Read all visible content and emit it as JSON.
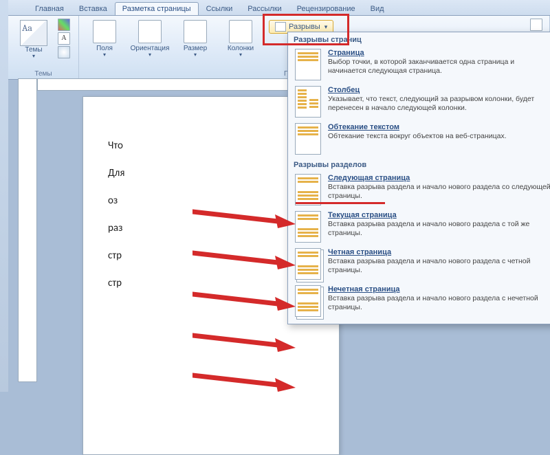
{
  "tabs": {
    "home": "Главная",
    "insert": "Вставка",
    "layout": "Разметка страницы",
    "refs": "Ссылки",
    "mail": "Рассылки",
    "review": "Рецензирование",
    "view": "Вид"
  },
  "ribbon": {
    "themes": {
      "btn": "Темы",
      "label": "Темы"
    },
    "pagesetup": {
      "margins": "Поля",
      "orient": "Ориентация",
      "size": "Размер",
      "cols": "Колонки",
      "label": "Параметры страни"
    },
    "breaks": "Разрывы"
  },
  "dropdown": {
    "sec1": "Разрывы страниц",
    "page": {
      "t": "Страница",
      "d": "Выбор точки, в которой заканчивается одна страница и начинается следующая страница."
    },
    "col": {
      "t": "Столбец",
      "d": "Указывает, что текст, следующий за разрывом колонки, будет перенесен в начало следующей колонки."
    },
    "wrap": {
      "t": "Обтекание текстом",
      "d": "Обтекание текста вокруг объектов на веб-страницах."
    },
    "sec2": "Разрывы разделов",
    "next": {
      "t": "Следующая страница",
      "d": "Вставка разрыва раздела и начало нового раздела со следующей страницы."
    },
    "cont": {
      "t": "Текущая страница",
      "d": "Вставка разрыва раздела и начало нового раздела с той же страницы."
    },
    "even": {
      "t": "Четная страница",
      "d": "Вставка разрыва раздела и начало нового раздела с четной страницы."
    },
    "odd": {
      "t": "Нечетная страница",
      "d": "Вставка разрыва раздела и начало нового раздела с нечетной страницы."
    }
  },
  "doc": {
    "l1": "Что",
    "l2": "Для",
    "l3": "оз",
    "l4": "раз",
    "l5": "стр",
    "l6": "стр"
  },
  "colors": {
    "highlight": "#d42a2a"
  }
}
